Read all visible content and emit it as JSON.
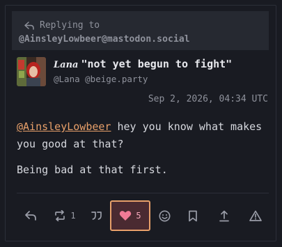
{
  "reply": {
    "label": "Replying to",
    "handle": "@AinsleyLowbeer@mastodon.social"
  },
  "author": {
    "script_name": "Lana",
    "display_name": "\"not yet begun to fight\"",
    "handle": "@Lana @beige.party"
  },
  "post": {
    "timestamp": "Sep 2, 2026, 04:34 UTC",
    "mention": "@AinsleyLowbeer",
    "line1_rest": " hey you know what makes you good at that?",
    "paragraph2": "Being bad at that first."
  },
  "actions": {
    "boost_count": "1",
    "favourite_count": "5"
  },
  "colors": {
    "background": "#191b22",
    "accent": "#e8a06a",
    "favourite": "#f07a96"
  },
  "icons": [
    "reply-arrow-icon",
    "reply-icon",
    "boost-icon",
    "quote-icon",
    "heart-icon",
    "emoji-icon",
    "bookmark-icon",
    "share-icon",
    "report-icon"
  ]
}
